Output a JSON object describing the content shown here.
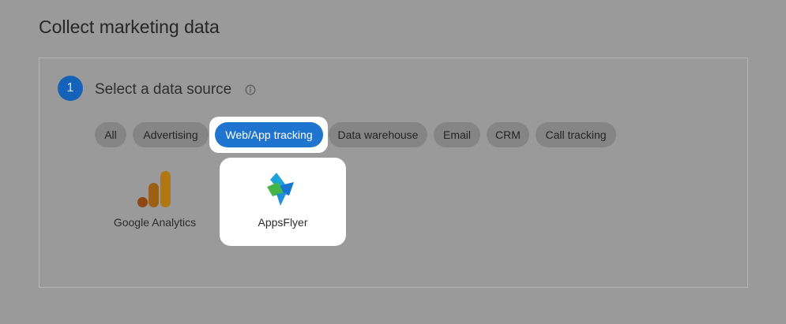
{
  "page": {
    "title": "Collect marketing data"
  },
  "step": {
    "number": "1",
    "title": "Select a data source",
    "info_icon": "info-icon"
  },
  "filters": {
    "selected": "Web/App tracking",
    "chips": [
      {
        "label": "All"
      },
      {
        "label": "Advertising"
      },
      {
        "label": "Web/App tracking"
      },
      {
        "label": "Data warehouse"
      },
      {
        "label": "Email"
      },
      {
        "label": "CRM"
      },
      {
        "label": "Call tracking"
      }
    ]
  },
  "sources": [
    {
      "label": "Google Analytics",
      "icon": "google-analytics-logo"
    },
    {
      "label": "AppsFlyer",
      "icon": "appsflyer-logo",
      "highlighted": true
    }
  ],
  "colors": {
    "overlay_background": "#9a9a9a",
    "step_circle": "#1463b8",
    "selected_chip": "#1f74cf",
    "chip": "#858585",
    "highlight": "#ffffff"
  }
}
